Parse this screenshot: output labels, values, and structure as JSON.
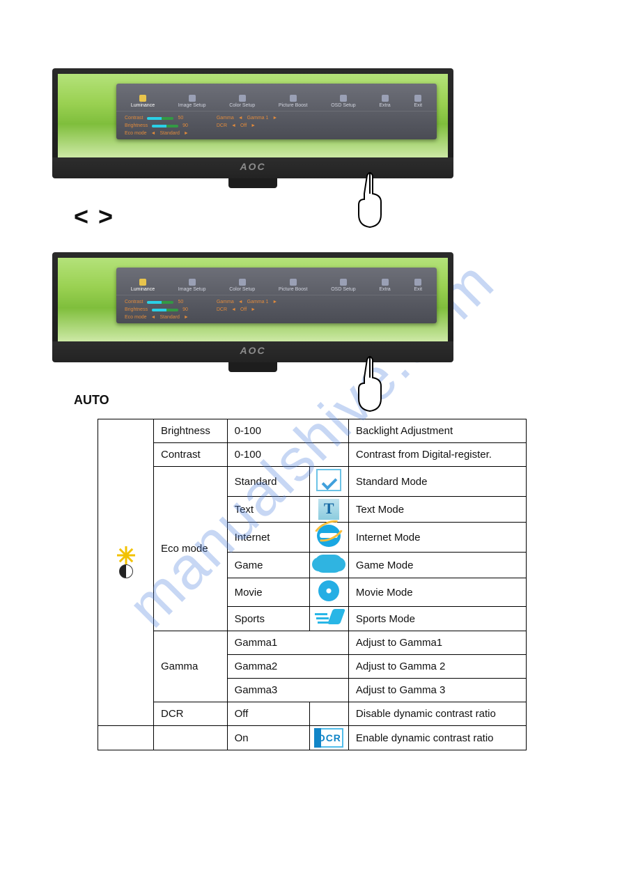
{
  "watermark": "manualshive.com",
  "monitor": {
    "brand": "AOC",
    "osd_tabs": [
      "Luminance",
      "Image Setup",
      "Color Setup",
      "Picture Boost",
      "OSD Setup",
      "Extra",
      "Exit"
    ],
    "osd_rows_left": [
      {
        "label": "Contrast",
        "val": "50"
      },
      {
        "label": "Brightness",
        "val": "90"
      },
      {
        "label": "Eco mode",
        "val": "Standard"
      }
    ],
    "osd_rows_right": [
      {
        "label": "Gamma",
        "val": "Gamma 1"
      },
      {
        "label": "DCR",
        "val": "Off"
      }
    ]
  },
  "nav": {
    "prev": "<",
    "next": ">"
  },
  "auto_heading": "AUTO",
  "table": {
    "rows": [
      {
        "param": "Brightness",
        "value": "0-100",
        "icon": null,
        "desc": "Backlight Adjustment",
        "group": "top"
      },
      {
        "param": "Contrast",
        "value": "0-100",
        "icon": null,
        "desc": "Contrast from Digital-register.",
        "group": "top"
      },
      {
        "param": "Eco mode",
        "value": "Standard",
        "icon": "check",
        "desc": "Standard Mode",
        "group": "eco",
        "rowspan": 6
      },
      {
        "param": "",
        "value": "Text",
        "icon": "text",
        "desc": "Text Mode",
        "group": "eco"
      },
      {
        "param": "",
        "value": "Internet",
        "icon": "ie",
        "desc": "Internet Mode",
        "group": "eco"
      },
      {
        "param": "",
        "value": "Game",
        "icon": "game",
        "desc": "Game Mode",
        "group": "eco"
      },
      {
        "param": "",
        "value": "Movie",
        "icon": "disc",
        "desc": "Movie Mode",
        "group": "eco"
      },
      {
        "param": "",
        "value": "Sports",
        "icon": "run",
        "desc": "Sports Mode",
        "group": "eco"
      },
      {
        "param": "Gamma",
        "value": "Gamma1",
        "icon": null,
        "desc": "Adjust to Gamma1",
        "group": "gamma",
        "rowspan": 3
      },
      {
        "param": "",
        "value": "Gamma2",
        "icon": null,
        "desc": "Adjust to Gamma 2",
        "group": "gamma"
      },
      {
        "param": "",
        "value": "Gamma3",
        "icon": null,
        "desc": "Adjust to Gamma 3",
        "group": "gamma"
      },
      {
        "param": "DCR",
        "value": "Off",
        "icon": null,
        "desc": "Disable dynamic contrast ratio",
        "group": "dcr"
      },
      {
        "param": "",
        "value": "On",
        "icon": "dcr",
        "desc": "Enable dynamic contrast ratio",
        "group": "dcr2"
      }
    ]
  }
}
